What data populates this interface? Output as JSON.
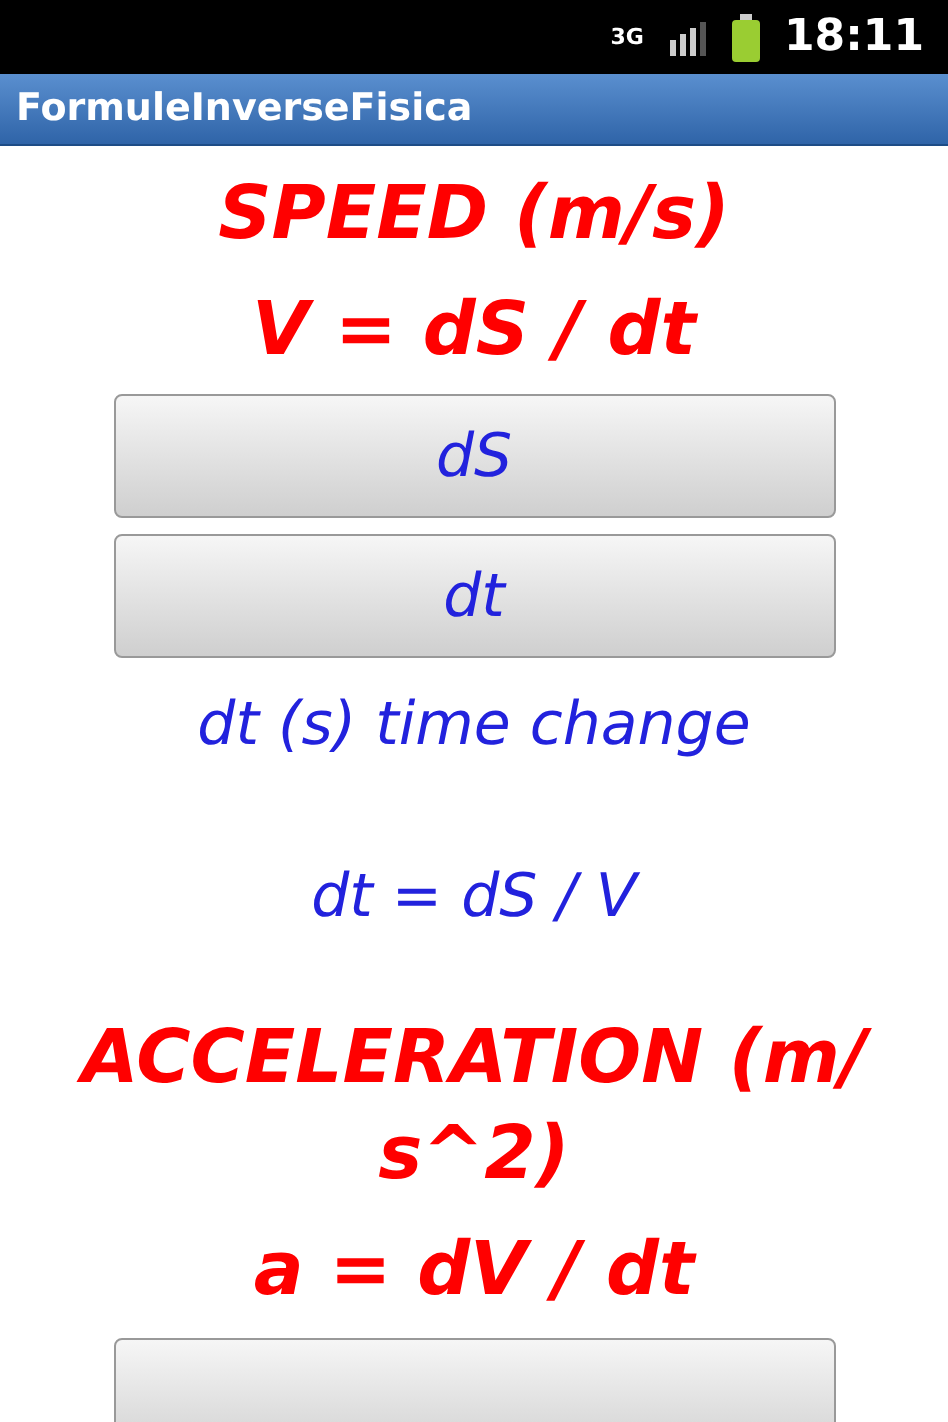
{
  "status_bar": {
    "network": "3G",
    "time": "18:11"
  },
  "app_bar": {
    "title": "FormuleInverseFisica"
  },
  "sections": [
    {
      "title_lines": [
        "SPEED (m/s)"
      ],
      "formula": "V = dS / dt",
      "buttons": [
        {
          "label": "dS"
        },
        {
          "label": "dt"
        }
      ],
      "explanation": "dt (s) time change",
      "result": "dt = dS / V"
    },
    {
      "title_lines": [
        "ACCELERATION (m/",
        "s^2)"
      ],
      "formula": "a = dV / dt",
      "cut_button": true
    }
  ]
}
